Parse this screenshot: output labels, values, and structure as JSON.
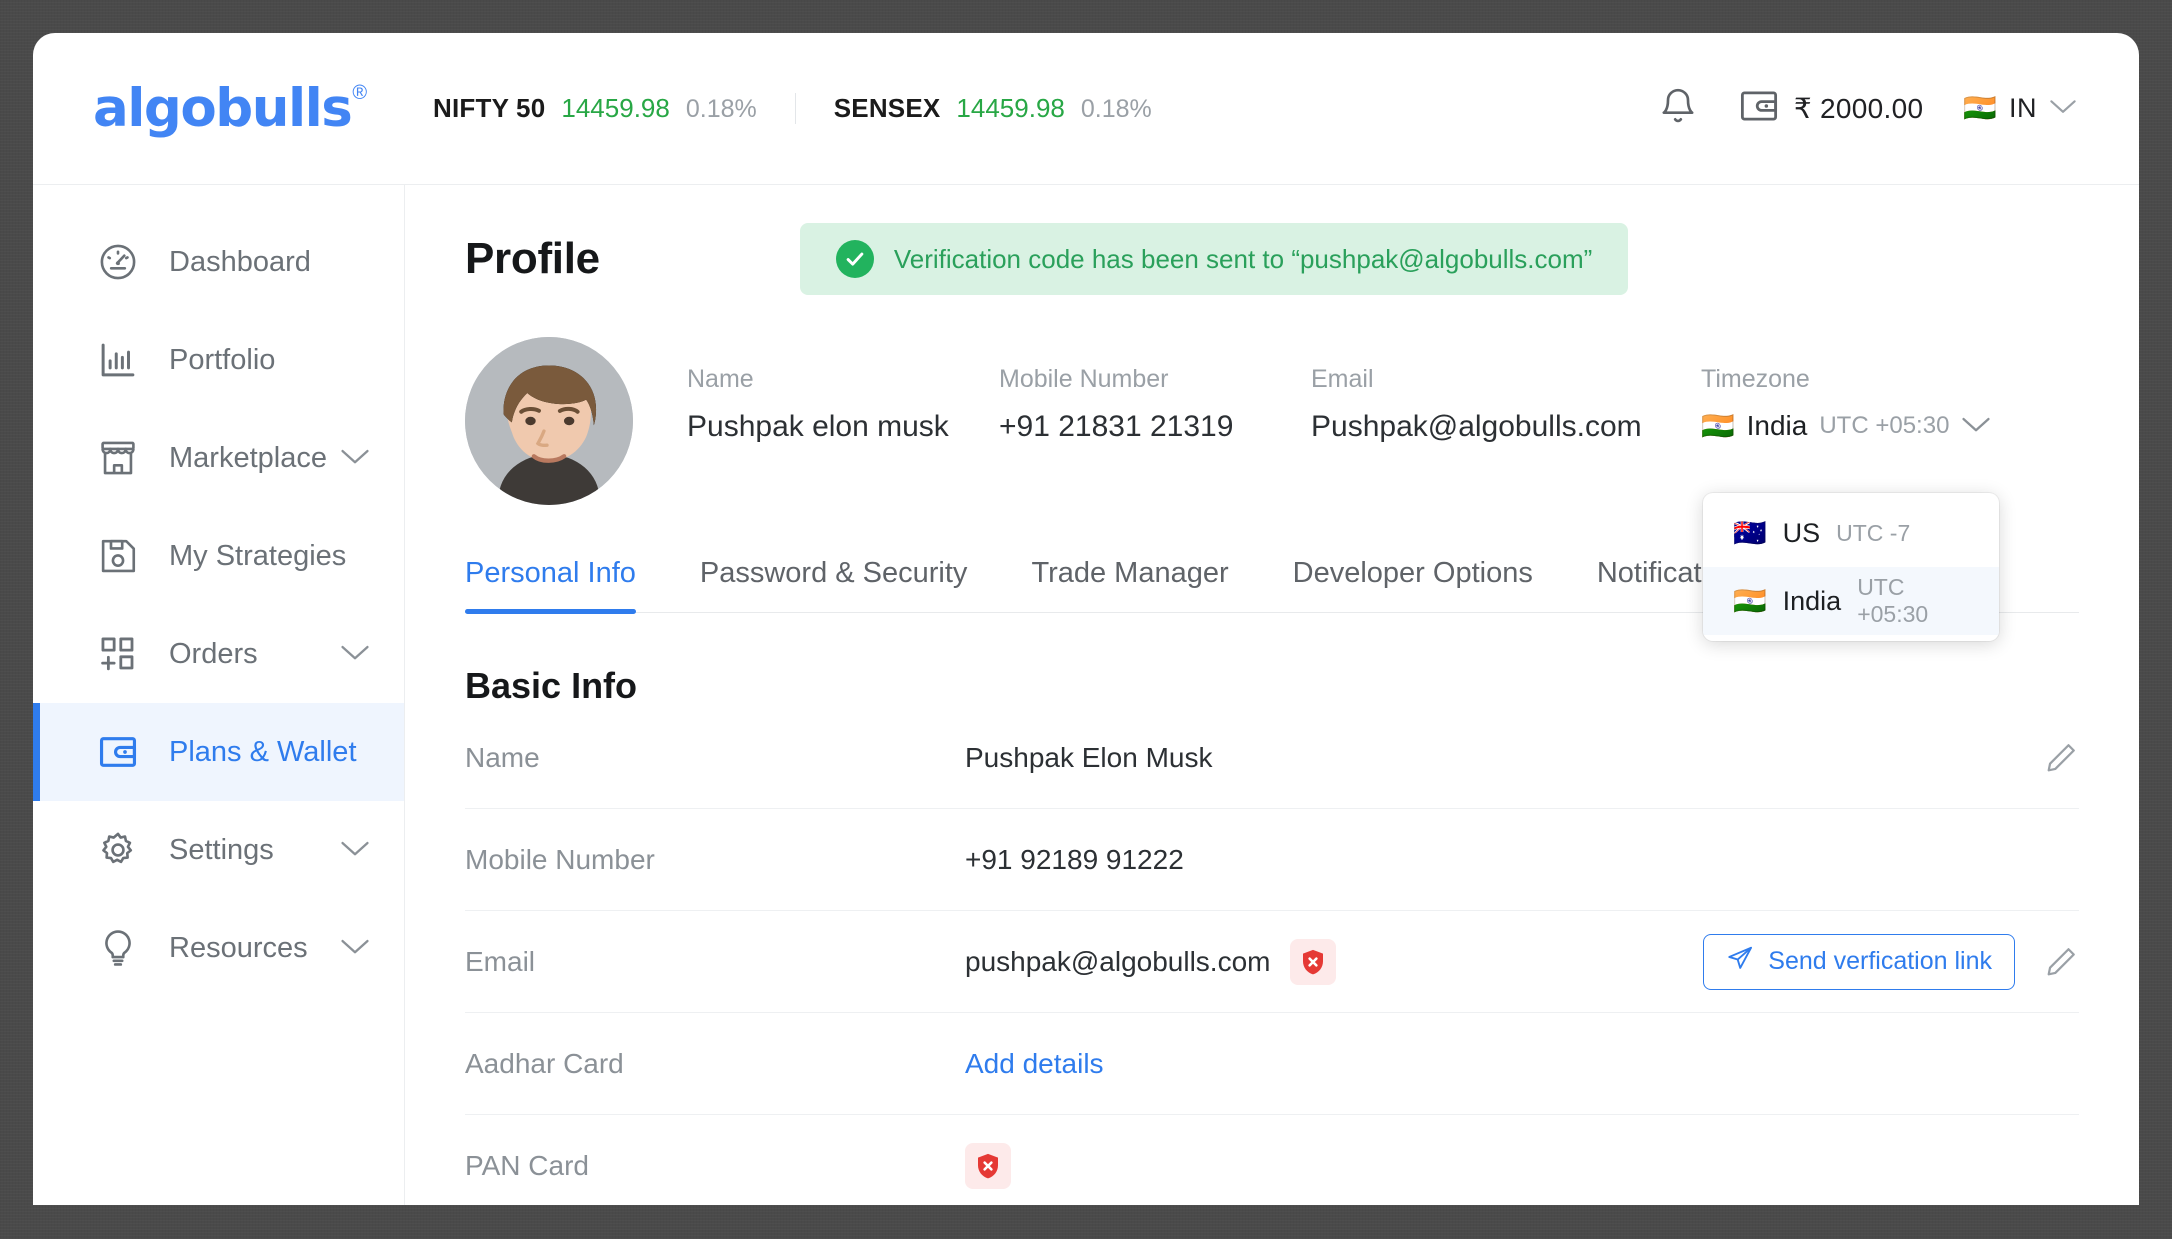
{
  "header": {
    "logo_text": "algobulls",
    "logo_registered": "®",
    "tickers": [
      {
        "name": "NIFTY 50",
        "value": "14459.98",
        "change": "0.18%"
      },
      {
        "name": "SENSEX",
        "value": "14459.98",
        "change": "0.18%"
      }
    ],
    "bell_icon": "bell-icon",
    "wallet_icon": "wallet-icon",
    "wallet_amount": "₹ 2000.00",
    "country_flag": "🇮🇳",
    "country_code": "IN",
    "country_caret": "chevron-down-icon"
  },
  "sidebar": {
    "items": [
      {
        "label": "Dashboard",
        "icon": "speedometer-icon",
        "expandable": false,
        "active": false
      },
      {
        "label": "Portfolio",
        "icon": "bar-chart-icon",
        "expandable": false,
        "active": false
      },
      {
        "label": "Marketplace",
        "icon": "storefront-icon",
        "expandable": true,
        "active": false
      },
      {
        "label": "My Strategies",
        "icon": "save-disk-icon",
        "expandable": false,
        "active": false
      },
      {
        "label": "Orders",
        "icon": "grid-plus-icon",
        "expandable": true,
        "active": false
      },
      {
        "label": "Plans & Wallet",
        "icon": "wallet-icon",
        "expandable": false,
        "active": true
      },
      {
        "label": "Settings",
        "icon": "gear-icon",
        "expandable": true,
        "active": false
      },
      {
        "label": "Resources",
        "icon": "lightbulb-icon",
        "expandable": true,
        "active": false
      }
    ]
  },
  "page": {
    "title": "Profile",
    "toast": {
      "icon": "check-circle-icon",
      "message": "Verification code has been sent to “pushpak@algobulls.com”"
    },
    "summary": {
      "avatar_alt": "user-avatar",
      "fields": [
        {
          "label": "Name",
          "value": "Pushpak elon musk"
        },
        {
          "label": "Mobile Number",
          "value": "+91 21831 21319"
        },
        {
          "label": "Email",
          "value": "Pushpak@algobulls.com"
        }
      ],
      "timezone": {
        "label": "Timezone",
        "flag": "🇮🇳",
        "country": "India",
        "offset": "UTC +05:30",
        "caret": "chevron-down-icon"
      }
    },
    "timezone_dropdown": {
      "options": [
        {
          "flag": "🇦🇺",
          "name": "US",
          "offset": "UTC -7",
          "selected": false
        },
        {
          "flag": "🇮🇳",
          "name": "India",
          "offset": "UTC +05:30",
          "selected": true
        }
      ]
    },
    "tabs": [
      {
        "label": "Personal Info",
        "active": true
      },
      {
        "label": "Password & Security",
        "active": false
      },
      {
        "label": "Trade Manager",
        "active": false
      },
      {
        "label": "Developer Options",
        "active": false
      },
      {
        "label": "Notifications",
        "active": false
      }
    ],
    "basic_info": {
      "section_title": "Basic Info",
      "rows": [
        {
          "label": "Name",
          "value": "Pushpak Elon Musk",
          "is_link": false,
          "badge": null,
          "send_button": null,
          "edit": true
        },
        {
          "label": "Mobile Number",
          "value": "+91 92189 91222",
          "is_link": false,
          "badge": null,
          "send_button": null,
          "edit": false
        },
        {
          "label": "Email",
          "value": "pushpak@algobulls.com",
          "is_link": false,
          "badge": "shield-x-icon",
          "send_button": "Send verfication link",
          "edit": true
        },
        {
          "label": "Aadhar Card",
          "value": "Add details",
          "is_link": true,
          "badge": null,
          "send_button": null,
          "edit": false
        },
        {
          "label": "PAN Card",
          "value": "",
          "is_link": false,
          "badge": "shield-x-icon",
          "send_button": null,
          "edit": false
        }
      ]
    }
  },
  "colors": {
    "brand_blue": "#2f7ced",
    "logo_blue": "#4285f4",
    "ticker_green": "#28a745",
    "toast_bg": "#d9f2e3",
    "toast_text": "#2aa05b",
    "danger_red": "#e53935",
    "muted_grey": "#9aa0a6"
  }
}
